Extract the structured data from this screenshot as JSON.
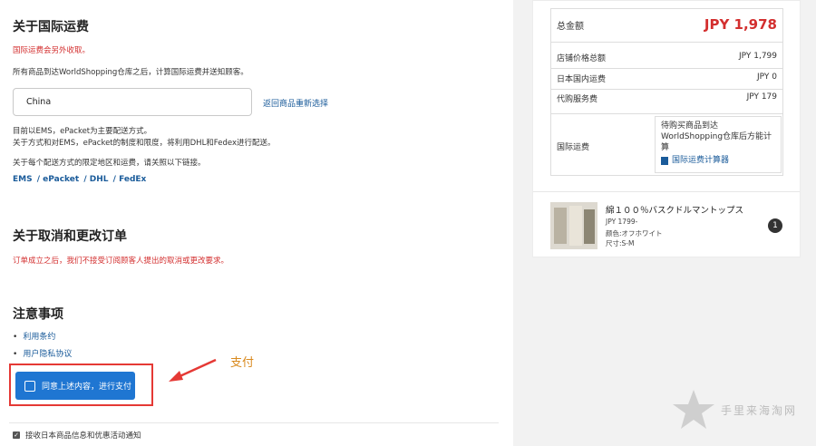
{
  "intl_shipping": {
    "title": "关于国际运费",
    "notice_red": "国际运费会另外收取。",
    "description": "所有商品到达WorldShopping仓库之后，计算国际运费并送知顾客。",
    "country_value": "China",
    "return_link": "返回商品重新选择",
    "text_line1": "目前以EMS，ePacket为主要配送方式。",
    "text_line2": "关于方式和对EMS，ePacket的制度和限度，将利用DHL和Fedex进行配送。",
    "text_line3": "关于每个配送方式的限定地区和运费，请关照以下链接。",
    "carriers": [
      "EMS",
      "ePacket",
      "DHL",
      "FedEx"
    ]
  },
  "cancel": {
    "title": "关于取消和更改订单",
    "notice_red": "订单成立之后，我们不接受订阅顾客人提出的取消或更改要求。"
  },
  "notes": {
    "title": "注意事项",
    "links": [
      "利用条约",
      "用户隐私协议"
    ]
  },
  "pay_button_label": "同意上述内容，进行支付",
  "annotation_label": "支付",
  "consent_label": "接收日本商品信息和优惠活动通知",
  "summary": {
    "total_label": "总金额",
    "total_value": "JPY 1,978",
    "rows": [
      {
        "label": "店铺价格总额",
        "value": "JPY 1,799"
      },
      {
        "label": "日本国内运费",
        "value": "JPY 0"
      },
      {
        "label": "代购服务费",
        "value": "JPY 179"
      }
    ],
    "intl_label": "国际运费",
    "intl_text": "待购买商品到达WorldShopping仓库后方能计算",
    "calc_link": "国际运费计算器"
  },
  "product": {
    "title": "綿１００％バスクドルマントップス",
    "price": "JPY 1799-",
    "color": "颜色:オフホワイト",
    "size": "尺寸:S-M",
    "quantity": "1"
  },
  "watermark": "手里来海淘网"
}
